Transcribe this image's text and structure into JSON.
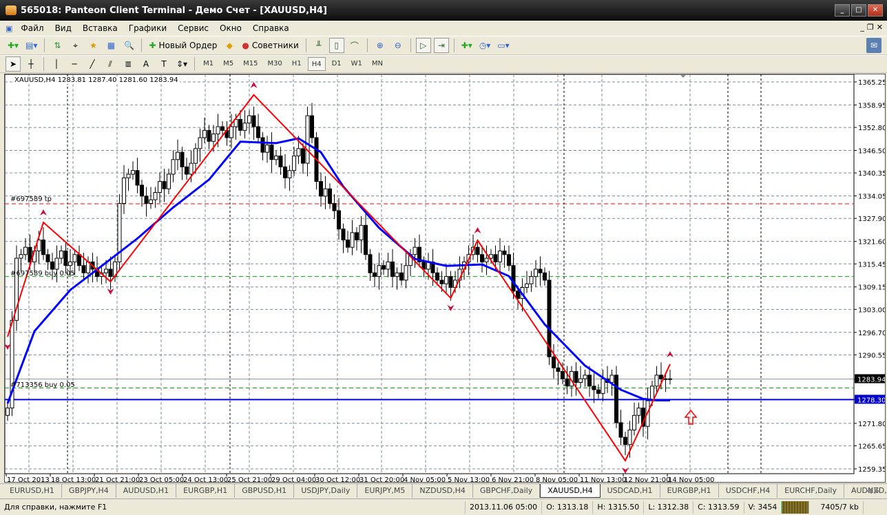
{
  "window": {
    "title": "565018: Panteon Client Terminal - Демо Счет - [XAUUSD,H4]"
  },
  "menu": [
    "Файл",
    "Вид",
    "Вставка",
    "Графики",
    "Сервис",
    "Окно",
    "Справка"
  ],
  "toolbar": {
    "new_order": "Новый Ордер",
    "experts": "Советники"
  },
  "timeframes": [
    "M1",
    "M5",
    "M15",
    "M30",
    "H1",
    "H4",
    "D1",
    "W1",
    "MN"
  ],
  "active_timeframe": "H4",
  "chart_header": "XAUUSD,H4  1283.81 1287.40 1281.60 1283.94",
  "order_labels": {
    "tp": "#697589 tp",
    "buy1": "#697589 buy 0.05",
    "buy2": "#713356 buy 0.05"
  },
  "tabs": [
    "EURUSD,H1",
    "GBPJPY,H4",
    "AUDUSD,H1",
    "EURGBP,H1",
    "GBPUSD,H1",
    "USDJPY,Daily",
    "EURJPY,M5",
    "NZDUSD,H4",
    "GBPCHF,Daily",
    "XAUUSD,H4",
    "USDCAD,H1",
    "EURGBP,H1",
    "USDCHF,H4",
    "EURCHF,Daily",
    "AUDNZD,Daily"
  ],
  "active_tab": "XAUUSD,H4",
  "status": {
    "help": "Для справки, нажмите F1",
    "time": "2013.11.06 05:00",
    "open": "O: 1313.18",
    "high": "H: 1315.50",
    "low": "L: 1312.38",
    "close": "C: 1313.59",
    "volume": "V: 3454",
    "traffic": "7405/7 kb"
  },
  "colors": {
    "bull": "#ffffff",
    "bear": "#000000",
    "ma": "#0000ff",
    "zigzag": "#ff0000",
    "fractal": "#c8103c",
    "buy_line": "#00aa00",
    "tp_line": "#ff0000"
  },
  "chart_data": {
    "type": "candlestick",
    "symbol": "XAUUSD",
    "timeframe": "H4",
    "ylim": [
      1259.35,
      1365.25
    ],
    "y_ticks": [
      "1365.25",
      "1358.95",
      "1352.80",
      "1346.50",
      "1340.35",
      "1334.05",
      "1327.90",
      "1321.60",
      "1315.45",
      "1309.15",
      "1303.00",
      "1296.70",
      "1290.55",
      "1283.94",
      "1278.30",
      "1271.80",
      "1265.65",
      "1259.35"
    ],
    "x_ticks": [
      "17 Oct 2013",
      "18 Oct 13:00",
      "21 Oct 21:00",
      "23 Oct 05:00",
      "24 Oct 13:00",
      "25 Oct 21:00",
      "29 Oct 04:00",
      "30 Oct 12:00",
      "31 Oct 20:00",
      "4 Nov 05:00",
      "5 Nov 13:00",
      "6 Nov 21:00",
      "8 Nov 05:00",
      "11 Nov 13:00",
      "12 Nov 21:00",
      "14 Nov 05:00"
    ],
    "closes": [
      1276,
      1300,
      1317,
      1318,
      1320,
      1316,
      1319,
      1322,
      1318,
      1316,
      1314,
      1317,
      1319,
      1315,
      1316,
      1318,
      1315,
      1313,
      1316,
      1314,
      1312,
      1313,
      1314,
      1312,
      1316,
      1332,
      1339,
      1340,
      1341,
      1337,
      1334,
      1332,
      1333,
      1335,
      1338,
      1336,
      1340,
      1344,
      1346,
      1342,
      1340,
      1343,
      1347,
      1350,
      1352,
      1349,
      1351,
      1353,
      1352,
      1350,
      1353,
      1355,
      1352,
      1354,
      1356,
      1353,
      1350,
      1346,
      1348,
      1344,
      1345,
      1342,
      1339,
      1341,
      1345,
      1347,
      1343,
      1356,
      1350,
      1338,
      1334,
      1336,
      1332,
      1330,
      1325,
      1322,
      1320,
      1324,
      1322,
      1326,
      1318,
      1313,
      1312,
      1315,
      1314,
      1316,
      1312,
      1313,
      1311,
      1315,
      1318,
      1320,
      1316,
      1314,
      1316,
      1313,
      1311,
      1310,
      1312,
      1309,
      1311,
      1314,
      1316,
      1318,
      1320,
      1318,
      1316,
      1317,
      1318,
      1316,
      1319,
      1318,
      1315,
      1308,
      1306,
      1309,
      1310,
      1312,
      1314,
      1313,
      1311,
      1290,
      1287,
      1286,
      1284,
      1282,
      1286,
      1283,
      1284,
      1285,
      1282,
      1281,
      1280,
      1284,
      1283,
      1285,
      1272,
      1268,
      1266,
      1270,
      1274,
      1276,
      1271,
      1278,
      1282,
      1285,
      1284,
      1284,
      1283.94
    ],
    "ma": [
      [
        0,
        1277.25
      ],
      [
        6,
        1297.0
      ],
      [
        14,
        1308.3
      ],
      [
        22,
        1315.8
      ],
      [
        29,
        1322.4
      ],
      [
        37,
        1330.9
      ],
      [
        45,
        1338.5
      ],
      [
        52,
        1348.9
      ],
      [
        60,
        1348.5
      ],
      [
        65,
        1349.8
      ],
      [
        70,
        1346.0
      ],
      [
        75,
        1336.6
      ],
      [
        83,
        1325.3
      ],
      [
        91,
        1316.8
      ],
      [
        98,
        1314.9
      ],
      [
        106,
        1315.3
      ],
      [
        112,
        1312.1
      ],
      [
        120,
        1298.9
      ],
      [
        129,
        1287.6
      ],
      [
        137,
        1281.0
      ],
      [
        142,
        1278.5
      ],
      [
        145,
        1278.1
      ],
      [
        148,
        1278.1
      ]
    ],
    "zigzag": [
      [
        0,
        1295.5
      ],
      [
        8,
        1326.8
      ],
      [
        23,
        1310.6
      ],
      [
        55,
        1361.7
      ],
      [
        99,
        1306.1
      ],
      [
        105,
        1321.9
      ],
      [
        138,
        1261.6
      ],
      [
        148,
        1288.0
      ]
    ],
    "levels": {
      "tp": 1331.9,
      "buy1": 1312.0,
      "buy2": 1281.5,
      "bid": 1283.94,
      "hline": 1278.3
    }
  }
}
